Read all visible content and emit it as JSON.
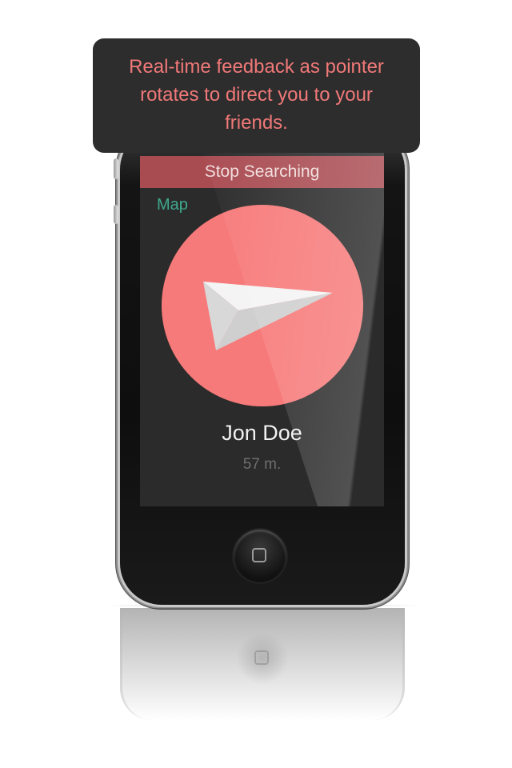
{
  "callout": {
    "text": "Real-time feedback as pointer rotates to direct you to your friends."
  },
  "screen": {
    "stop_button_label": "Stop Searching",
    "map_link_label": "Map",
    "friend": {
      "name": "Jon Doe",
      "distance": "57 m."
    }
  },
  "colors": {
    "compass_fill": "#f77a7a",
    "arrow_fill": "#e9e9e9",
    "arrow_shadow": "#cfcfcf",
    "stop_bar": "#a94c52",
    "map_link": "#3fa88e",
    "callout_text": "#f07878",
    "callout_bg": "#2d2d2d"
  },
  "icons": {
    "pointer": "paper-plane-arrow-icon",
    "home": "home-button-square-icon"
  }
}
